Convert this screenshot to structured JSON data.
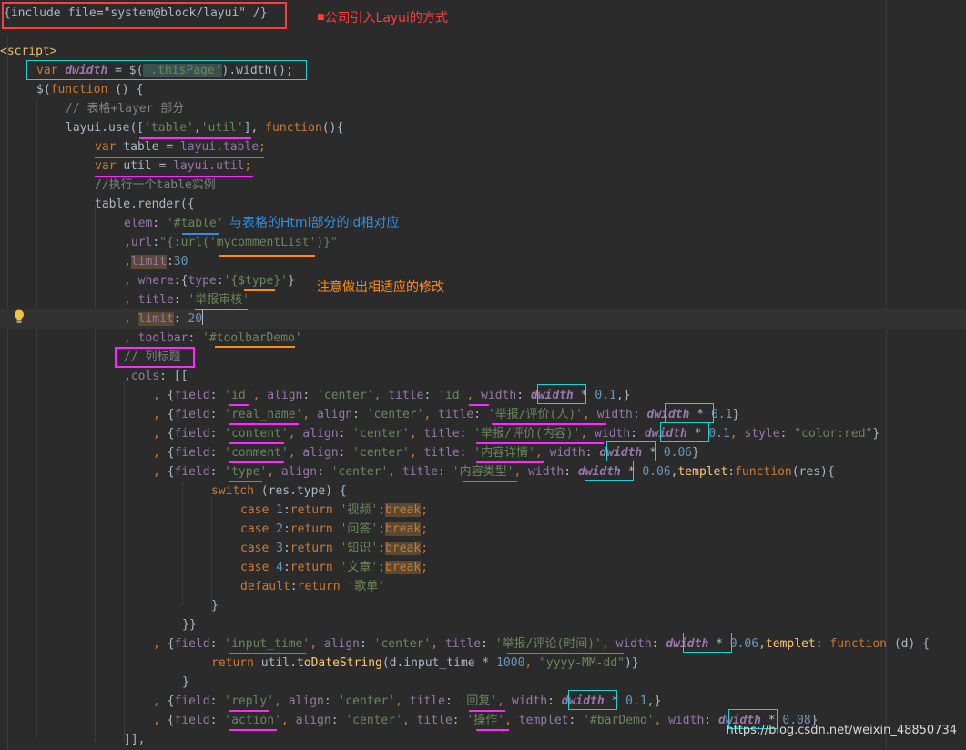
{
  "lines": [
    {
      "tokens": [
        [
          "pl",
          "{include file=\"system@block/layui\" /}"
        ]
      ]
    },
    {
      "tokens": []
    },
    {
      "tokens": [
        [
          "tag",
          "<script>"
        ]
      ]
    },
    {
      "tokens": [
        [
          "kw",
          "var "
        ],
        [
          "it",
          "dwidth"
        ],
        [
          "pl",
          " = $("
        ],
        [
          "str",
          "'.thisPage'"
        ],
        [
          "pl",
          ").width();"
        ]
      ]
    },
    {
      "tokens": [
        [
          "pl",
          "$("
        ],
        [
          "kw",
          "function "
        ],
        [
          "pl",
          "() {"
        ]
      ]
    },
    {
      "tokens": [
        [
          "cm",
          "// 表格+layer 部分"
        ]
      ]
    },
    {
      "tokens": [
        [
          "pl",
          "layui.use(["
        ],
        [
          "str",
          "'table'"
        ],
        [
          "pl",
          ","
        ],
        [
          "str",
          "'util'"
        ],
        [
          "pl",
          "], "
        ],
        [
          "kw",
          "function"
        ],
        [
          "pl",
          "(){"
        ]
      ]
    },
    {
      "tokens": [
        [
          "kw",
          "var "
        ],
        [
          "pl",
          "table = "
        ],
        [
          "prop",
          "layui.table"
        ],
        [
          "kw",
          ";"
        ]
      ]
    },
    {
      "tokens": [
        [
          "kw",
          "var "
        ],
        [
          "pl",
          "util = "
        ],
        [
          "prop",
          "layui.util"
        ],
        [
          "kw",
          ";"
        ]
      ]
    },
    {
      "tokens": [
        [
          "cm",
          "//执行一个table实例"
        ]
      ]
    },
    {
      "tokens": [
        [
          "pl",
          "table.render({"
        ]
      ]
    },
    {
      "tokens": [
        [
          "prop",
          "elem"
        ],
        [
          "pl",
          ": "
        ],
        [
          "str",
          "'#table'"
        ]
      ]
    },
    {
      "tokens": [
        [
          "pl",
          ","
        ],
        [
          "prop",
          "url"
        ],
        [
          "pl",
          ":"
        ],
        [
          "str",
          "\"{:url('mycommentList')}\""
        ]
      ]
    },
    {
      "tokens": [
        [
          "pl",
          ","
        ],
        [
          "prop",
          "limit"
        ],
        [
          "pl",
          ":"
        ],
        [
          "num",
          "30"
        ]
      ]
    },
    {
      "tokens": [
        [
          "kw",
          ", "
        ],
        [
          "prop",
          "where"
        ],
        [
          "pl",
          ":{"
        ],
        [
          "prop",
          "type"
        ],
        [
          "pl",
          ":"
        ],
        [
          "str",
          "'{$type}'"
        ],
        [
          "pl",
          "}"
        ]
      ]
    },
    {
      "tokens": [
        [
          "kw",
          ", "
        ],
        [
          "prop",
          "title"
        ],
        [
          "pl",
          ": "
        ],
        [
          "str",
          "'举报审核'"
        ]
      ]
    },
    {
      "tokens": [
        [
          "kw",
          ", "
        ],
        [
          "prop",
          "limit"
        ],
        [
          "pl",
          ": "
        ],
        [
          "num",
          "20"
        ]
      ]
    },
    {
      "tokens": [
        [
          "kw",
          ", "
        ],
        [
          "prop",
          "toolbar"
        ],
        [
          "pl",
          ": "
        ],
        [
          "str",
          "'#toolbarDemo'"
        ]
      ]
    },
    {
      "tokens": [
        [
          "cm",
          "// 列标题"
        ]
      ]
    },
    {
      "tokens": [
        [
          "pl",
          ","
        ],
        [
          "prop",
          "cols"
        ],
        [
          "pl",
          ": [["
        ]
      ]
    },
    {
      "tokens": [
        [
          "kw",
          ", "
        ],
        [
          "pl",
          "{"
        ],
        [
          "prop",
          "field"
        ],
        [
          "pl",
          ": "
        ],
        [
          "str",
          "'id'"
        ],
        [
          "kw",
          ", "
        ],
        [
          "prop",
          "align"
        ],
        [
          "pl",
          ": "
        ],
        [
          "str",
          "'center'"
        ],
        [
          "kw",
          ", "
        ],
        [
          "prop",
          "title"
        ],
        [
          "pl",
          ": "
        ],
        [
          "str",
          "'id'"
        ],
        [
          "kw",
          ", "
        ],
        [
          "prop",
          "width"
        ],
        [
          "pl",
          ": "
        ],
        [
          "it",
          "dwidth"
        ],
        [
          "pl",
          " * "
        ],
        [
          "num",
          "0.1"
        ],
        [
          "pl",
          ",}"
        ]
      ]
    },
    {
      "tokens": [
        [
          "kw",
          ", "
        ],
        [
          "pl",
          "{"
        ],
        [
          "prop",
          "field"
        ],
        [
          "pl",
          ": "
        ],
        [
          "str",
          "'real_name'"
        ],
        [
          "kw",
          ", "
        ],
        [
          "prop",
          "align"
        ],
        [
          "pl",
          ": "
        ],
        [
          "str",
          "'center'"
        ],
        [
          "kw",
          ", "
        ],
        [
          "prop",
          "title"
        ],
        [
          "pl",
          ": "
        ],
        [
          "str",
          "'举报/评价(人)'"
        ],
        [
          "kw",
          ", "
        ],
        [
          "prop",
          "width"
        ],
        [
          "pl",
          ": "
        ],
        [
          "it",
          "dwidth"
        ],
        [
          "pl",
          " * "
        ],
        [
          "num",
          "0.1"
        ],
        [
          "pl",
          "}"
        ]
      ]
    },
    {
      "tokens": [
        [
          "kw",
          ", "
        ],
        [
          "pl",
          "{"
        ],
        [
          "prop",
          "field"
        ],
        [
          "pl",
          ": "
        ],
        [
          "str",
          "'content'"
        ],
        [
          "kw",
          ", "
        ],
        [
          "prop",
          "align"
        ],
        [
          "pl",
          ": "
        ],
        [
          "str",
          "'center'"
        ],
        [
          "kw",
          ", "
        ],
        [
          "prop",
          "title"
        ],
        [
          "pl",
          ": "
        ],
        [
          "str",
          "'举报/评价(内容)'"
        ],
        [
          "kw",
          ", "
        ],
        [
          "prop",
          "width"
        ],
        [
          "pl",
          ": "
        ],
        [
          "it",
          "dwidth"
        ],
        [
          "pl",
          " * "
        ],
        [
          "num",
          "0.1"
        ],
        [
          "kw",
          ", "
        ],
        [
          "prop",
          "style"
        ],
        [
          "pl",
          ": "
        ],
        [
          "str",
          "\"color:red\""
        ],
        [
          "pl",
          "}"
        ]
      ]
    },
    {
      "tokens": [
        [
          "kw",
          ", "
        ],
        [
          "pl",
          "{"
        ],
        [
          "prop",
          "field"
        ],
        [
          "pl",
          ": "
        ],
        [
          "str",
          "'comment'"
        ],
        [
          "kw",
          ", "
        ],
        [
          "prop",
          "align"
        ],
        [
          "pl",
          ": "
        ],
        [
          "str",
          "'center'"
        ],
        [
          "kw",
          ", "
        ],
        [
          "prop",
          "title"
        ],
        [
          "pl",
          ": "
        ],
        [
          "str",
          "'内容详情'"
        ],
        [
          "kw",
          ", "
        ],
        [
          "prop",
          "width"
        ],
        [
          "pl",
          ": "
        ],
        [
          "it",
          "dwidth"
        ],
        [
          "pl",
          " * "
        ],
        [
          "num",
          "0.06"
        ],
        [
          "pl",
          "}"
        ]
      ]
    },
    {
      "tokens": [
        [
          "kw",
          ", "
        ],
        [
          "pl",
          "{"
        ],
        [
          "prop",
          "field"
        ],
        [
          "pl",
          ": "
        ],
        [
          "str",
          "'type'"
        ],
        [
          "kw",
          ", "
        ],
        [
          "prop",
          "align"
        ],
        [
          "pl",
          ": "
        ],
        [
          "str",
          "'center'"
        ],
        [
          "kw",
          ", "
        ],
        [
          "prop",
          "title"
        ],
        [
          "pl",
          ": "
        ],
        [
          "str",
          "'内容类型'"
        ],
        [
          "kw",
          ", "
        ],
        [
          "prop",
          "width"
        ],
        [
          "pl",
          ": "
        ],
        [
          "it",
          "dwidth"
        ],
        [
          "pl",
          " * "
        ],
        [
          "num",
          "0.06"
        ],
        [
          "pl",
          ","
        ],
        [
          "fn",
          "templet"
        ],
        [
          "pl",
          ":"
        ],
        [
          "kw",
          "function"
        ],
        [
          "pl",
          "(res){"
        ]
      ]
    },
    {
      "tokens": [
        [
          "kw",
          "switch "
        ],
        [
          "pl",
          "(res.type) {"
        ]
      ]
    },
    {
      "tokens": [
        [
          "kw",
          "case "
        ],
        [
          "num",
          "1"
        ],
        [
          "pl",
          ":"
        ],
        [
          "kw",
          "return "
        ],
        [
          "str",
          "'视频'"
        ],
        [
          "kw",
          ";"
        ],
        [
          "kw",
          "break"
        ],
        [
          "kw",
          ";"
        ]
      ]
    },
    {
      "tokens": [
        [
          "kw",
          "case "
        ],
        [
          "num",
          "2"
        ],
        [
          "pl",
          ":"
        ],
        [
          "kw",
          "return "
        ],
        [
          "str",
          "'问答'"
        ],
        [
          "kw",
          ";"
        ],
        [
          "kw",
          "break"
        ],
        [
          "kw",
          ";"
        ]
      ]
    },
    {
      "tokens": [
        [
          "kw",
          "case "
        ],
        [
          "num",
          "3"
        ],
        [
          "pl",
          ":"
        ],
        [
          "kw",
          "return "
        ],
        [
          "str",
          "'知识'"
        ],
        [
          "kw",
          ";"
        ],
        [
          "kw",
          "break"
        ],
        [
          "kw",
          ";"
        ]
      ]
    },
    {
      "tokens": [
        [
          "kw",
          "case "
        ],
        [
          "num",
          "4"
        ],
        [
          "pl",
          ":"
        ],
        [
          "kw",
          "return "
        ],
        [
          "str",
          "'文章'"
        ],
        [
          "kw",
          ";"
        ],
        [
          "kw",
          "break"
        ],
        [
          "kw",
          ";"
        ]
      ]
    },
    {
      "tokens": [
        [
          "kw",
          "default"
        ],
        [
          "pl",
          ":"
        ],
        [
          "kw",
          "return "
        ],
        [
          "str",
          "'歌单'"
        ]
      ]
    },
    {
      "tokens": [
        [
          "pl",
          "}"
        ]
      ]
    },
    {
      "tokens": [
        [
          "pl",
          "}}"
        ]
      ]
    },
    {
      "tokens": [
        [
          "kw",
          ", "
        ],
        [
          "pl",
          "{"
        ],
        [
          "prop",
          "field"
        ],
        [
          "pl",
          ": "
        ],
        [
          "str",
          "'input_time'"
        ],
        [
          "kw",
          ", "
        ],
        [
          "prop",
          "align"
        ],
        [
          "pl",
          ": "
        ],
        [
          "str",
          "'center'"
        ],
        [
          "kw",
          ", "
        ],
        [
          "prop",
          "title"
        ],
        [
          "pl",
          ": "
        ],
        [
          "str",
          "'举报/评论(时间)'"
        ],
        [
          "kw",
          ", "
        ],
        [
          "prop",
          "width"
        ],
        [
          "pl",
          ": "
        ],
        [
          "it",
          "dwidth"
        ],
        [
          "pl",
          " * "
        ],
        [
          "num",
          "0.06"
        ],
        [
          "pl",
          ","
        ],
        [
          "fn",
          "templet"
        ],
        [
          "pl",
          ": "
        ],
        [
          "kw",
          "function "
        ],
        [
          "pl",
          "(d) {"
        ]
      ]
    },
    {
      "tokens": [
        [
          "kw",
          "return "
        ],
        [
          "pl",
          "util."
        ],
        [
          "fn",
          "toDateString"
        ],
        [
          "pl",
          "(d.input_time * "
        ],
        [
          "num",
          "1000"
        ],
        [
          "kw",
          ", "
        ],
        [
          "str",
          "\"yyyy-MM-dd\""
        ],
        [
          "pl",
          ")}"
        ]
      ]
    },
    {
      "tokens": [
        [
          "pl",
          "}"
        ]
      ]
    },
    {
      "tokens": [
        [
          "kw",
          ", "
        ],
        [
          "pl",
          "{"
        ],
        [
          "prop",
          "field"
        ],
        [
          "pl",
          ": "
        ],
        [
          "str",
          "'reply'"
        ],
        [
          "kw",
          ", "
        ],
        [
          "prop",
          "align"
        ],
        [
          "pl",
          ": "
        ],
        [
          "str",
          "'center'"
        ],
        [
          "kw",
          ", "
        ],
        [
          "prop",
          "title"
        ],
        [
          "pl",
          ": "
        ],
        [
          "str",
          "'回复'"
        ],
        [
          "kw",
          ", "
        ],
        [
          "prop",
          "width"
        ],
        [
          "pl",
          ": "
        ],
        [
          "it",
          "dwidth"
        ],
        [
          "pl",
          " * "
        ],
        [
          "num",
          "0.1"
        ],
        [
          "pl",
          ",}"
        ]
      ]
    },
    {
      "tokens": [
        [
          "kw",
          ", "
        ],
        [
          "pl",
          "{"
        ],
        [
          "prop",
          "field"
        ],
        [
          "pl",
          ": "
        ],
        [
          "str",
          "'action'"
        ],
        [
          "kw",
          ", "
        ],
        [
          "prop",
          "align"
        ],
        [
          "pl",
          ": "
        ],
        [
          "str",
          "'center'"
        ],
        [
          "kw",
          ", "
        ],
        [
          "prop",
          "title"
        ],
        [
          "pl",
          ": "
        ],
        [
          "str",
          "'操作'"
        ],
        [
          "kw",
          ", "
        ],
        [
          "prop",
          "templet"
        ],
        [
          "pl",
          ": "
        ],
        [
          "str",
          "'#barDemo'"
        ],
        [
          "kw",
          ", "
        ],
        [
          "prop",
          "width"
        ],
        [
          "pl",
          ": "
        ],
        [
          "it",
          "dwidth"
        ],
        [
          "pl",
          " * "
        ],
        [
          "num",
          "0.08"
        ],
        [
          "pl",
          "}"
        ]
      ]
    },
    {
      "tokens": [
        [
          "pl",
          "]],"
        ]
      ]
    }
  ],
  "annotations": {
    "include_note": "公司引入Layui的方式",
    "table_note": "与表格的Html部分的id相对应",
    "modify_note": "注意做出相适应的修改"
  },
  "watermark": "https://blog.csdn.net/weixin_48850734",
  "colors": {
    "background": "#2b2b2b",
    "keyword": "#cc7832",
    "string": "#6a8759",
    "number": "#6897bb",
    "comment": "#808080",
    "property": "#9876aa",
    "function": "#ffc66d",
    "plain": "#a9b7c6",
    "annotation_red": "#ff3b3b",
    "annotation_blue": "#2e8fe6",
    "annotation_orange": "#ff8a1c",
    "annotation_magenta": "#ff28ff",
    "annotation_cyan": "#22d1d1"
  },
  "icons": {
    "gutter": "lightbulb-icon"
  }
}
